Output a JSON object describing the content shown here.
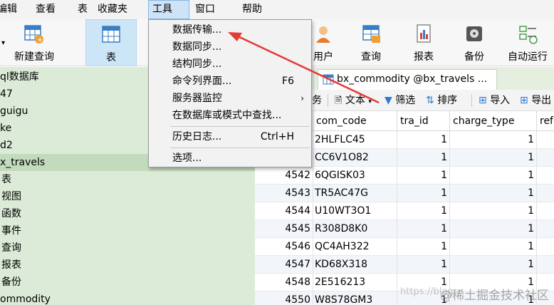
{
  "menubar": {
    "items": [
      {
        "label": "编辑"
      },
      {
        "label": "查看"
      },
      {
        "label": "表"
      },
      {
        "label": "收藏夹"
      },
      {
        "label": "工具"
      },
      {
        "label": "窗口"
      },
      {
        "label": "帮助"
      }
    ]
  },
  "toolbar": {
    "items": [
      {
        "label": "新建查询"
      },
      {
        "label": "表"
      },
      {
        "label": "用户"
      },
      {
        "label": "查询"
      },
      {
        "label": "报表"
      },
      {
        "label": "备份"
      },
      {
        "label": "自动运行"
      }
    ]
  },
  "sidebar": {
    "items": [
      {
        "label": "ql数据库"
      },
      {
        "label": "47"
      },
      {
        "label": "guigu"
      },
      {
        "label": "ke"
      },
      {
        "label": "d2"
      },
      {
        "label": "x_travels"
      },
      {
        "label": "表"
      },
      {
        "label": "视图"
      },
      {
        "label": "函数"
      },
      {
        "label": "事件"
      },
      {
        "label": "查询"
      },
      {
        "label": "报表"
      },
      {
        "label": "备份"
      },
      {
        "label": "ommodity"
      }
    ]
  },
  "tab": {
    "label": "bx_commodity @bx_travels ..."
  },
  "subtoolbar": {
    "partial": "务",
    "text": "文本",
    "filter": "筛选",
    "sort": "排序",
    "import": "导入",
    "export": "导出"
  },
  "grid": {
    "columns": [
      "com_code",
      "tra_id",
      "charge_type",
      "refe"
    ],
    "rows": [
      {
        "id": "",
        "code": "2HLFLC45",
        "tra_id": "1",
        "charge_type": "1"
      },
      {
        "id": "",
        "code": "CC6V1O82",
        "tra_id": "1",
        "charge_type": "1"
      },
      {
        "id": "4542",
        "code": "6QGISK03",
        "tra_id": "1",
        "charge_type": "1"
      },
      {
        "id": "4543",
        "code": "TR5AC47G",
        "tra_id": "1",
        "charge_type": "1"
      },
      {
        "id": "4544",
        "code": "U10WT3O1",
        "tra_id": "1",
        "charge_type": "1"
      },
      {
        "id": "4545",
        "code": "R308D8K0",
        "tra_id": "1",
        "charge_type": "1"
      },
      {
        "id": "4546",
        "code": "QC4AH322",
        "tra_id": "1",
        "charge_type": "1"
      },
      {
        "id": "4547",
        "code": "KD68X318",
        "tra_id": "1",
        "charge_type": "1"
      },
      {
        "id": "4548",
        "code": "2E516213",
        "tra_id": "1",
        "charge_type": "1"
      },
      {
        "id": "4550",
        "code": "W8S78GM3",
        "tra_id": "1",
        "charge_type": "1"
      }
    ]
  },
  "dropdown": {
    "items": [
      {
        "label": "数据传输...",
        "shortcut": ""
      },
      {
        "label": "数据同步...",
        "shortcut": ""
      },
      {
        "label": "结构同步...",
        "shortcut": ""
      },
      {
        "label": "命令列界面...",
        "shortcut": "F6"
      },
      {
        "label": "服务器监控",
        "shortcut": ""
      },
      {
        "label": "在数据库或模式中查找...",
        "shortcut": ""
      },
      {
        "label": "历史日志...",
        "shortcut": "Ctrl+H"
      },
      {
        "label": "选项...",
        "shortcut": ""
      }
    ],
    "submenu_glyph": "›"
  },
  "watermark": {
    "line1": "https://blog",
    "line2": "@稀土掘金技术社区"
  },
  "colors": {
    "arrow": "#e53935",
    "sidebar_bg": "#dcebd7",
    "menu_active": "#cfe3f6"
  }
}
